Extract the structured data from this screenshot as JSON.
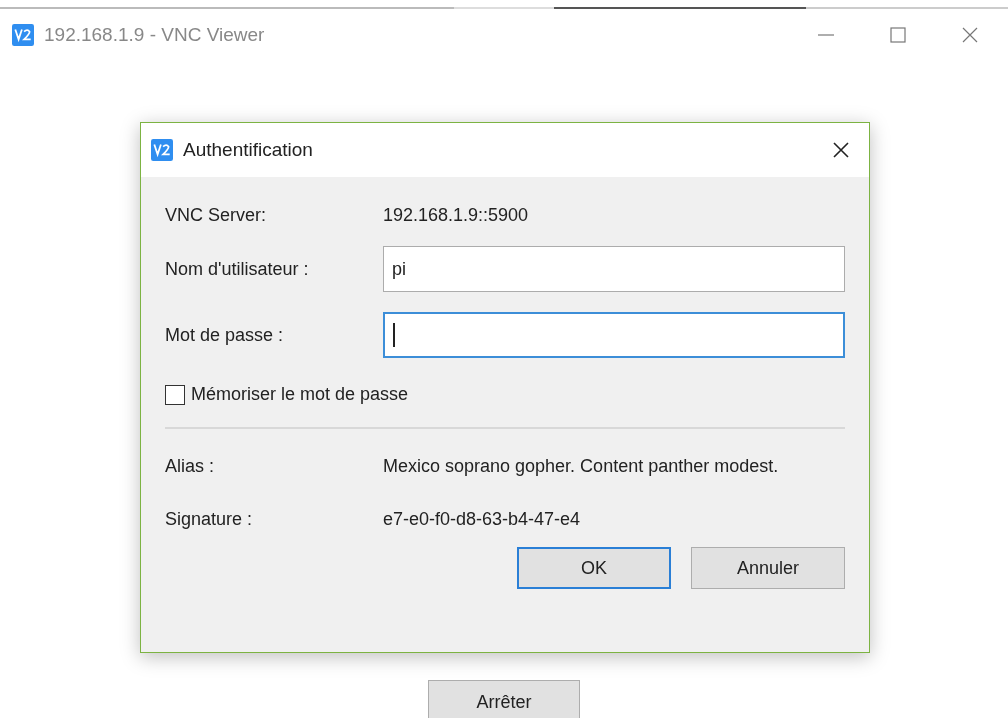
{
  "window": {
    "title": "192.168.1.9 - VNC Viewer"
  },
  "dialog": {
    "title": "Authentification",
    "fields": [
      {
        "kind": "text",
        "label": "VNC Server:",
        "value": "192.168.1.9::5900"
      },
      {
        "kind": "input",
        "label": "Nom d'utilisateur :",
        "value": "pi",
        "focused": false
      },
      {
        "kind": "input",
        "label": "Mot de passe :",
        "focused": true
      }
    ],
    "remember": {
      "label": "Mémoriser le mot de passe",
      "checked": false
    },
    "details": [
      {
        "label": "Alias :",
        "value": "Mexico soprano gopher. Content panther modest."
      },
      {
        "label": "Signature :",
        "value": "e7-e0-f0-d8-63-b4-47-e4"
      }
    ],
    "buttons": [
      {
        "label": "OK",
        "default": true
      },
      {
        "label": "Annuler",
        "default": false
      }
    ]
  },
  "stop_button": {
    "label": "Arrêter"
  }
}
